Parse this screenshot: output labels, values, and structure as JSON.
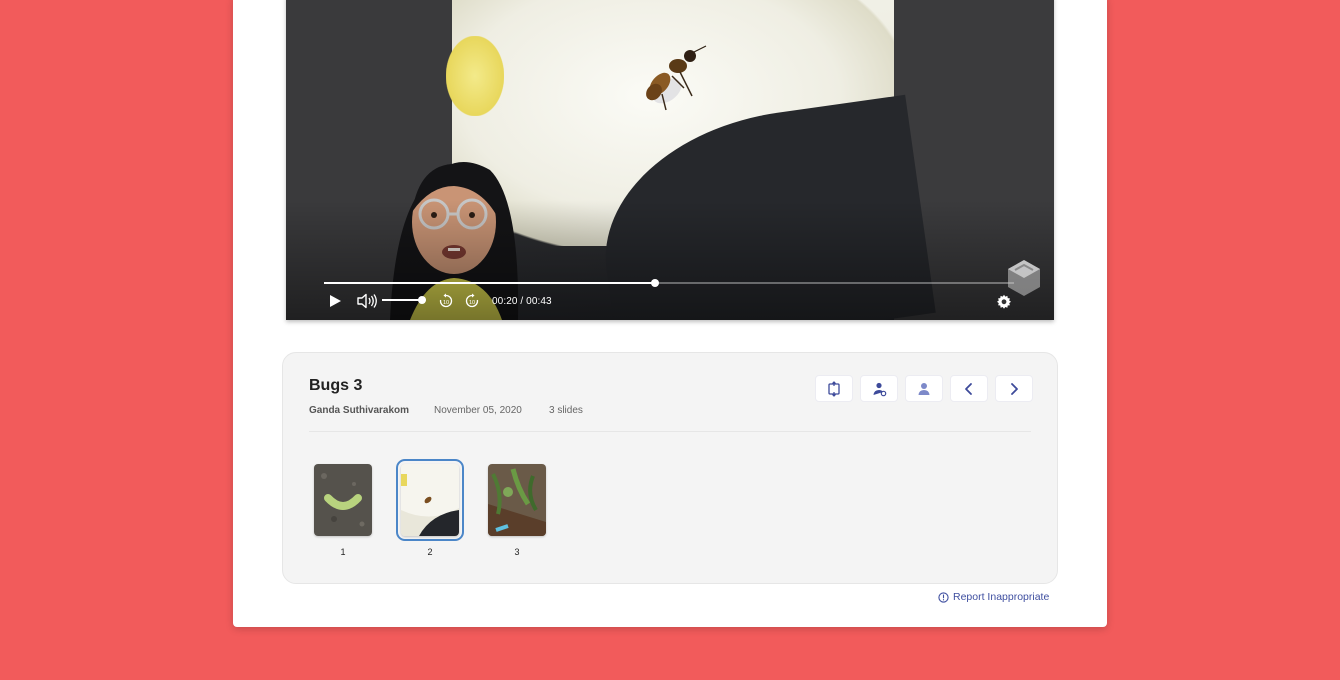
{
  "player": {
    "time_display": "00:20 / 00:43",
    "progress": 0.48,
    "buffered": 0.44,
    "volume": 0.9
  },
  "presentation": {
    "title": "Bugs 3",
    "author": "Ganda Suthivarakom",
    "date": "November 05, 2020",
    "slide_count": "3 slides"
  },
  "toolbar": {
    "icons": [
      "fullscreen-icon",
      "share-icon",
      "profile-icon",
      "chevron-left-icon",
      "chevron-right-icon"
    ]
  },
  "slides": [
    {
      "number": "1",
      "selected": false
    },
    {
      "number": "2",
      "selected": true
    },
    {
      "number": "3",
      "selected": false
    }
  ],
  "footer": {
    "report_label": "Report Inappropriate"
  },
  "colors": {
    "background": "#f25b5b",
    "accent": "#3f4fa0",
    "selected_outline": "#4b86c8"
  }
}
